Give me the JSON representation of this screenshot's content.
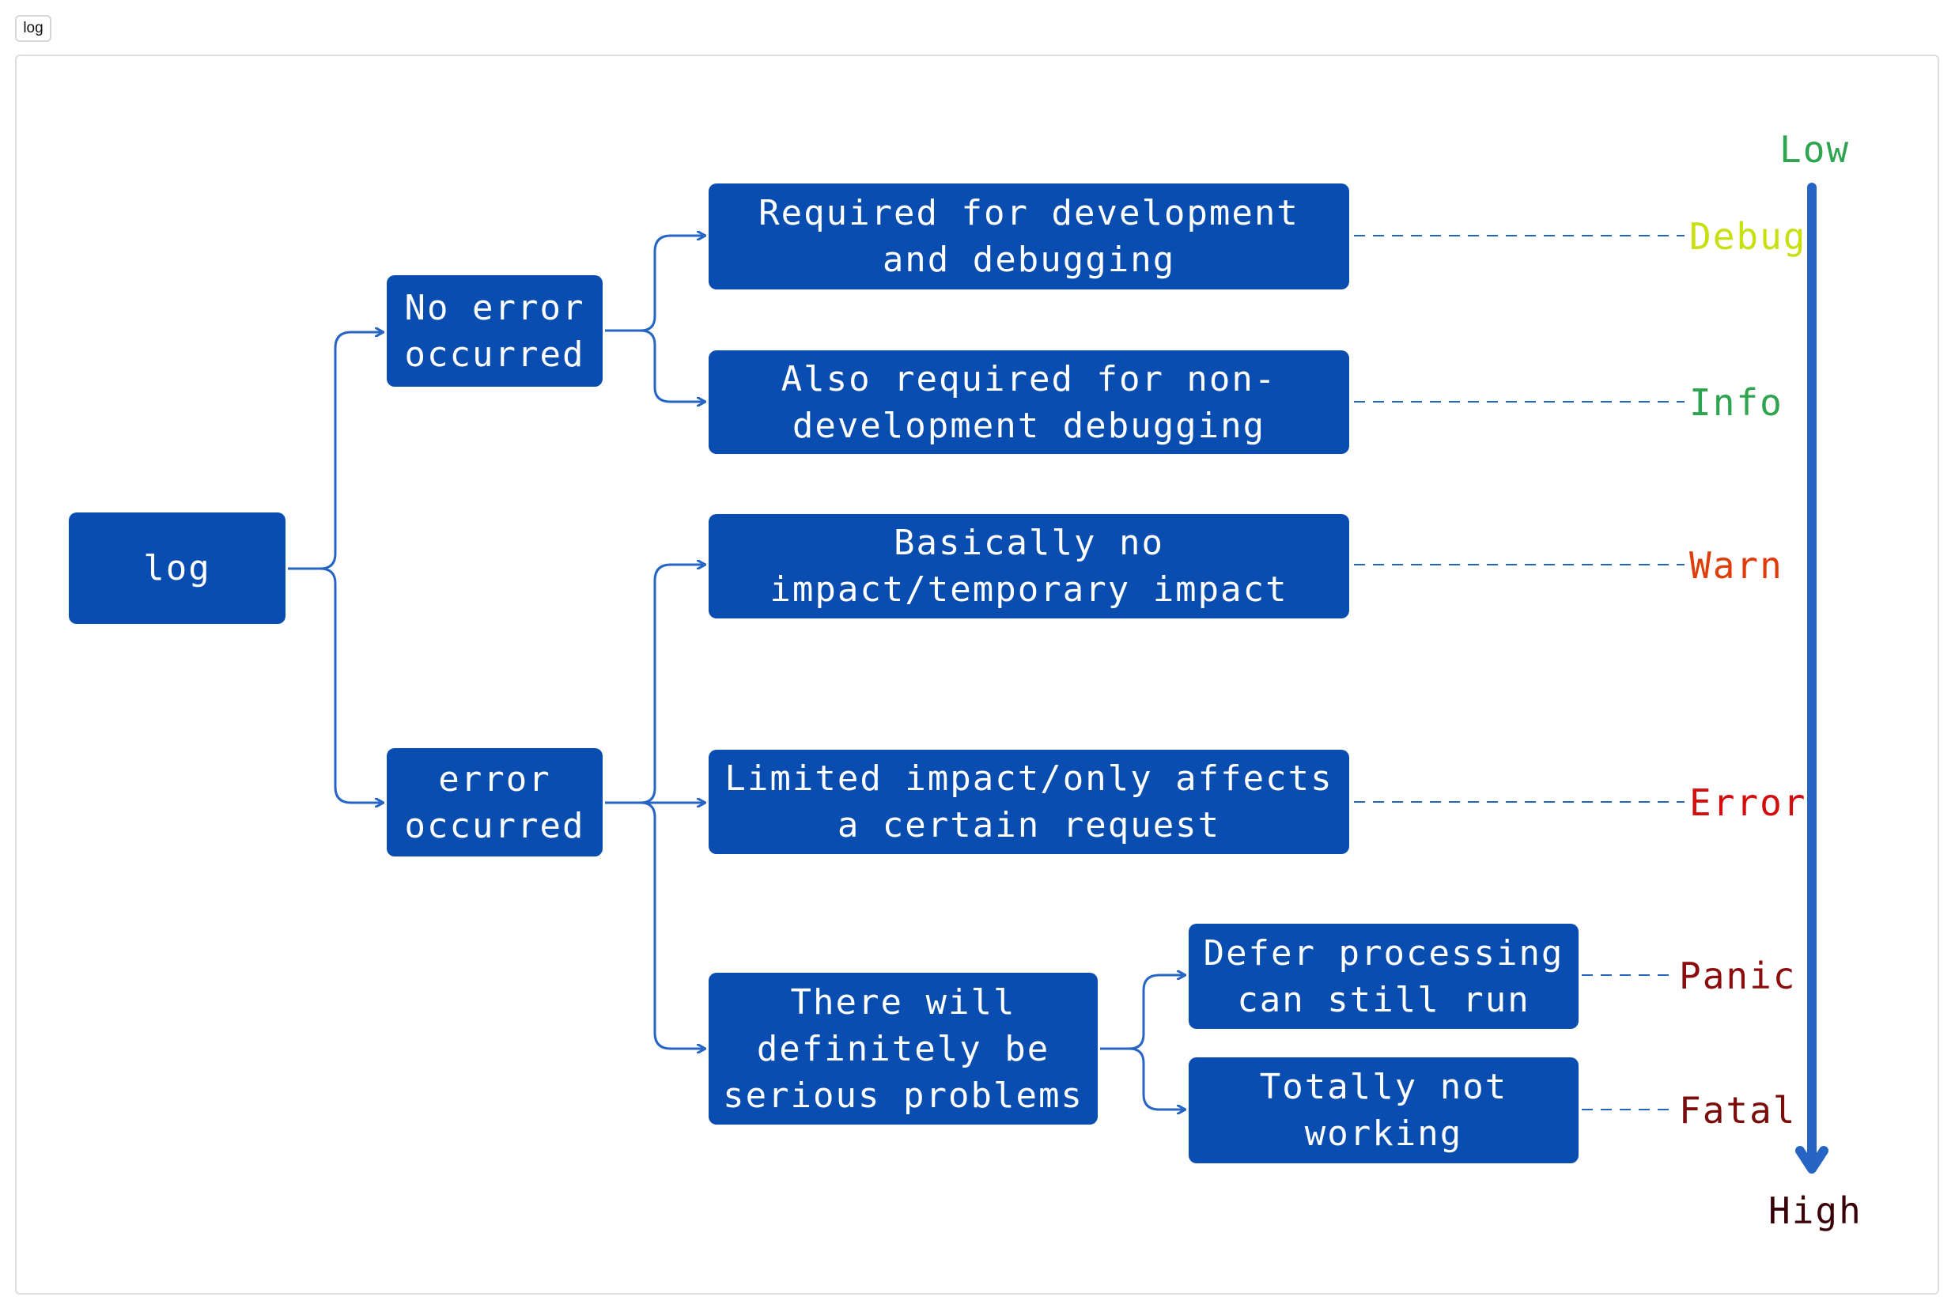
{
  "tab": {
    "label": "log"
  },
  "diagram": {
    "root": "log",
    "branches": {
      "no_error": "No error occurred",
      "error": "error occurred"
    },
    "cases": {
      "debug": "Required for development and debugging",
      "info": "Also required for non-development debugging",
      "warn": "Basically no impact/temporary impact",
      "error": "Limited impact/only affects a certain request",
      "serious": "There will definitely be serious problems",
      "panic": "Defer processing can still run",
      "fatal": "Totally not working"
    },
    "levels": [
      {
        "name": "Debug",
        "color": "#c8e010"
      },
      {
        "name": "Info",
        "color": "#2ea44f"
      },
      {
        "name": "Warn",
        "color": "#e03c08"
      },
      {
        "name": "Error",
        "color": "#d40c0c"
      },
      {
        "name": "Panic",
        "color": "#8b0c0c"
      },
      {
        "name": "Fatal",
        "color": "#7a0c0c"
      }
    ],
    "scale": {
      "low": "Low",
      "high": "High",
      "low_color": "#2ea44f",
      "high_color": "#3a0008"
    },
    "box_color": "#0a4db0",
    "connector_color": "#2765c4"
  }
}
